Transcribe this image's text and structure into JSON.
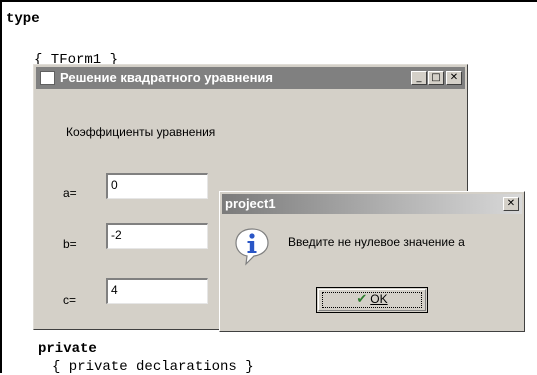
{
  "code": {
    "line_type": "type",
    "line_comment": "{ TForm1 }",
    "line_private": "private",
    "line_private_decl": "{ private declarations }"
  },
  "main_window": {
    "title": "Решение квадратного уравнения",
    "coef_label": "Коэффициенты уравнения",
    "fields": [
      {
        "label": "a=",
        "value": "0"
      },
      {
        "label": "b=",
        "value": "-2"
      },
      {
        "label": "c=",
        "value": "4"
      }
    ],
    "buttons": {
      "minimize": "_",
      "maximize": "□",
      "close": "✕"
    }
  },
  "dialog": {
    "title": "project1",
    "message": "Введите не нулевое значение а",
    "ok_label": "OK",
    "ok_underline": "O",
    "close": "✕",
    "icon": "info-icon"
  },
  "colors": {
    "face": "#d4d0c8",
    "info_blue": "#2a56c6"
  }
}
